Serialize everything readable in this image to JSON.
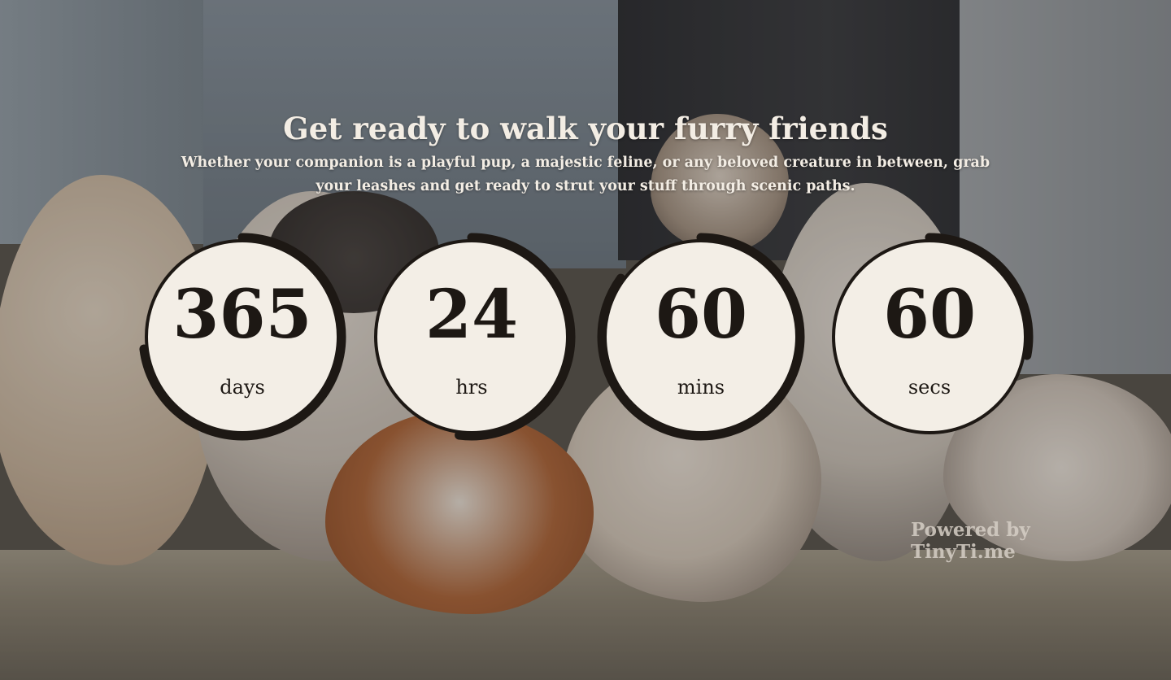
{
  "heading": {
    "title": "Get ready to walk your furry friends",
    "subtitle": "Whether your companion is a playful pup, a majestic feline, or any beloved creature in between, grab your leashes and get ready to strut your stuff through scenic paths."
  },
  "countdown": [
    {
      "value": "365",
      "unit": "days",
      "progress": 0.73
    },
    {
      "value": "24",
      "unit": "hrs",
      "progress": 0.52
    },
    {
      "value": "60",
      "unit": "mins",
      "progress": 0.85
    },
    {
      "value": "60",
      "unit": "secs",
      "progress": 0.28
    }
  ],
  "footer": {
    "powered_by": "Powered by TinyTi.me"
  },
  "colors": {
    "circle_fill": "#f3eee6",
    "ring": "#1d1814",
    "text": "#1d1814",
    "heading_text": "#f3ede4"
  }
}
